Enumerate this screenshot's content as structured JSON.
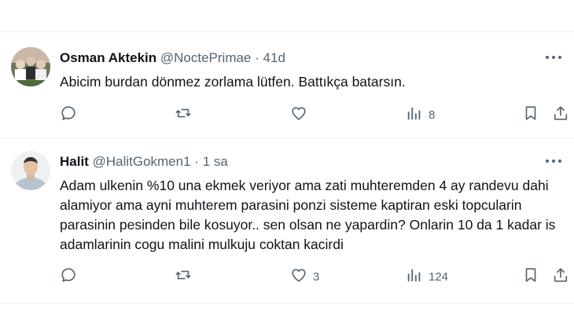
{
  "tweets": [
    {
      "name": "Osman Aktekin",
      "handle": "@NoctePrimae",
      "separator": "·",
      "time": "41d",
      "text": "Abicim burdan dönmez zorlama lütfen. Battıkça batarsın.",
      "replies": "",
      "retweets": "",
      "likes": "",
      "views": "8"
    },
    {
      "name": "Halit",
      "handle": "@HalitGokmen1",
      "separator": "·",
      "time": "1 sa",
      "text": "Adam ulkenin %10 una ekmek veriyor ama zati muhteremden 4 ay randevu dahi alamiyor ama ayni muhterem parasini ponzi sisteme kaptiran eski topcularin parasinin pesinden bile kosuyor.. sen olsan ne yapardin? Onlarin 10 da 1 kadar is adamlarinin cogu malini mulkuju coktan kacirdi",
      "replies": "",
      "retweets": "",
      "likes": "3",
      "views": "124"
    }
  ],
  "colors": {
    "text": "#0f1419",
    "secondary": "#536471",
    "divider": "#eff3f4"
  },
  "icons": [
    "more-icon",
    "reply-icon",
    "retweet-icon",
    "like-icon",
    "views-icon",
    "bookmark-icon",
    "share-icon"
  ]
}
